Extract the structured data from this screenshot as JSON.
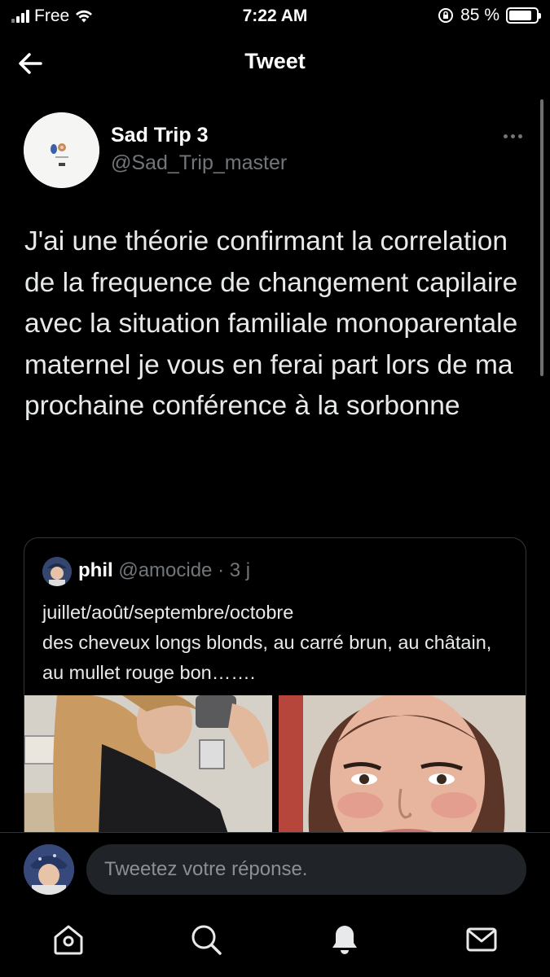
{
  "status_bar": {
    "carrier": "Free",
    "time": "7:22 AM",
    "battery": "85 %",
    "battery_level": 0.85
  },
  "header": {
    "title": "Tweet"
  },
  "tweet": {
    "author_name": "Sad Trip 3",
    "author_handle": "@Sad_Trip_master",
    "text": "J'ai une théorie confirmant la correlation de la frequence de changement capilaire avec la situation familiale monoparentale maternel je vous en ferai part lors de ma prochaine conférence à la sorbonne"
  },
  "quote": {
    "name": "phil",
    "handle": "@amocide",
    "separator": " · ",
    "time": "3 j",
    "line1": "juillet/août/septembre/octobre",
    "line2": "des cheveux longs blonds, au carré brun, au châtain, au mullet rouge bon……."
  },
  "reply": {
    "placeholder": "Tweetez votre réponse."
  },
  "colors": {
    "background": "#000000",
    "text": "#e7e9ea",
    "secondary": "#71767b",
    "input_bg": "#202327"
  },
  "icons": [
    "back-arrow-icon",
    "more-icon",
    "home-icon",
    "search-icon",
    "notifications-bell-icon",
    "messages-envelope-icon",
    "wifi-icon",
    "signal-icon",
    "battery-icon",
    "orientation-lock-icon"
  ]
}
